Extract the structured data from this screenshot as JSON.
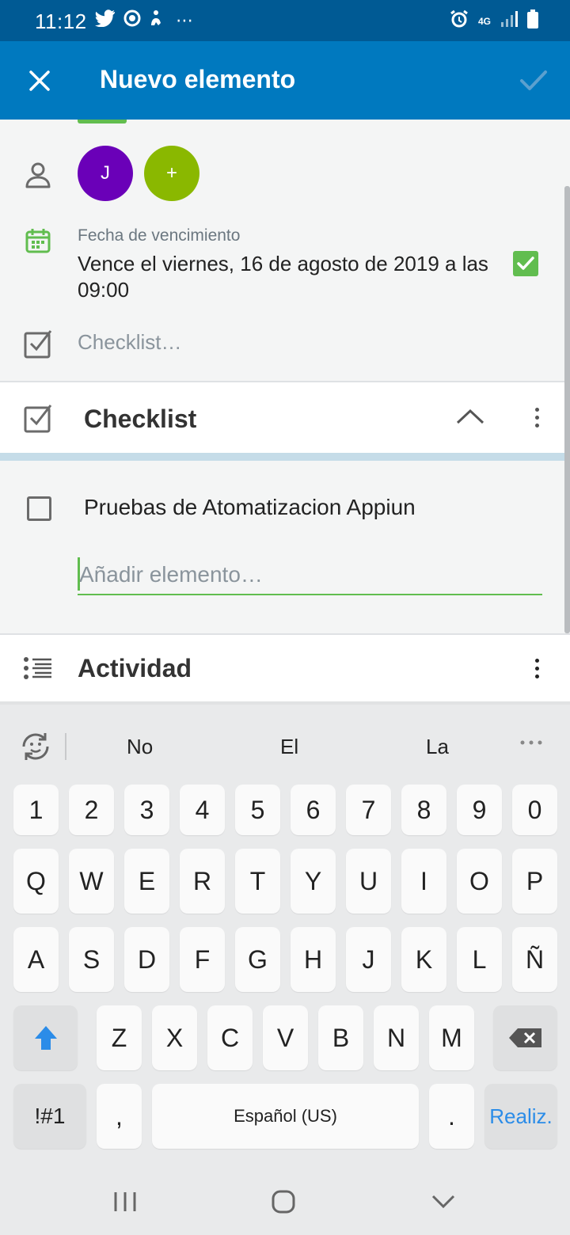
{
  "status_bar": {
    "time": "11:12",
    "network": "4G",
    "more": "⋯"
  },
  "app_bar": {
    "title": "Nuevo elemento"
  },
  "members": {
    "avatar_initial": "J",
    "add_label": "+",
    "avatar_color": "#6a00b8",
    "add_color": "#8ab800"
  },
  "due": {
    "label": "Fecha de vencimiento",
    "value": "Vence el viernes, 16 de agosto de 2019 a las 09:00",
    "checked": true
  },
  "checklist_shortcut": {
    "label": "Checklist…"
  },
  "checklist": {
    "title": "Checklist",
    "progress_percent": 0,
    "items": [
      {
        "text": "Pruebas de Atomatizacion Appiun",
        "checked": false
      }
    ],
    "add_placeholder": "Añadir elemento…"
  },
  "activity": {
    "title": "Actividad"
  },
  "keyboard": {
    "suggestions": [
      "No",
      "El",
      "La"
    ],
    "row_numbers": [
      "1",
      "2",
      "3",
      "4",
      "5",
      "6",
      "7",
      "8",
      "9",
      "0"
    ],
    "row_top": [
      "Q",
      "W",
      "E",
      "R",
      "T",
      "Y",
      "U",
      "I",
      "O",
      "P"
    ],
    "row_home": [
      "A",
      "S",
      "D",
      "F",
      "G",
      "H",
      "J",
      "K",
      "L",
      "Ñ"
    ],
    "row_bottom": [
      "Z",
      "X",
      "C",
      "V",
      "B",
      "N",
      "M"
    ],
    "symbols_label": "!#1",
    "comma_label": ",",
    "space_label": "Español (US)",
    "period_label": ".",
    "done_label": "Realiz."
  },
  "colors": {
    "primary": "#0079bf",
    "status": "#005a94",
    "accent_green": "#61bd4f",
    "link_blue": "#2b8ce8"
  }
}
